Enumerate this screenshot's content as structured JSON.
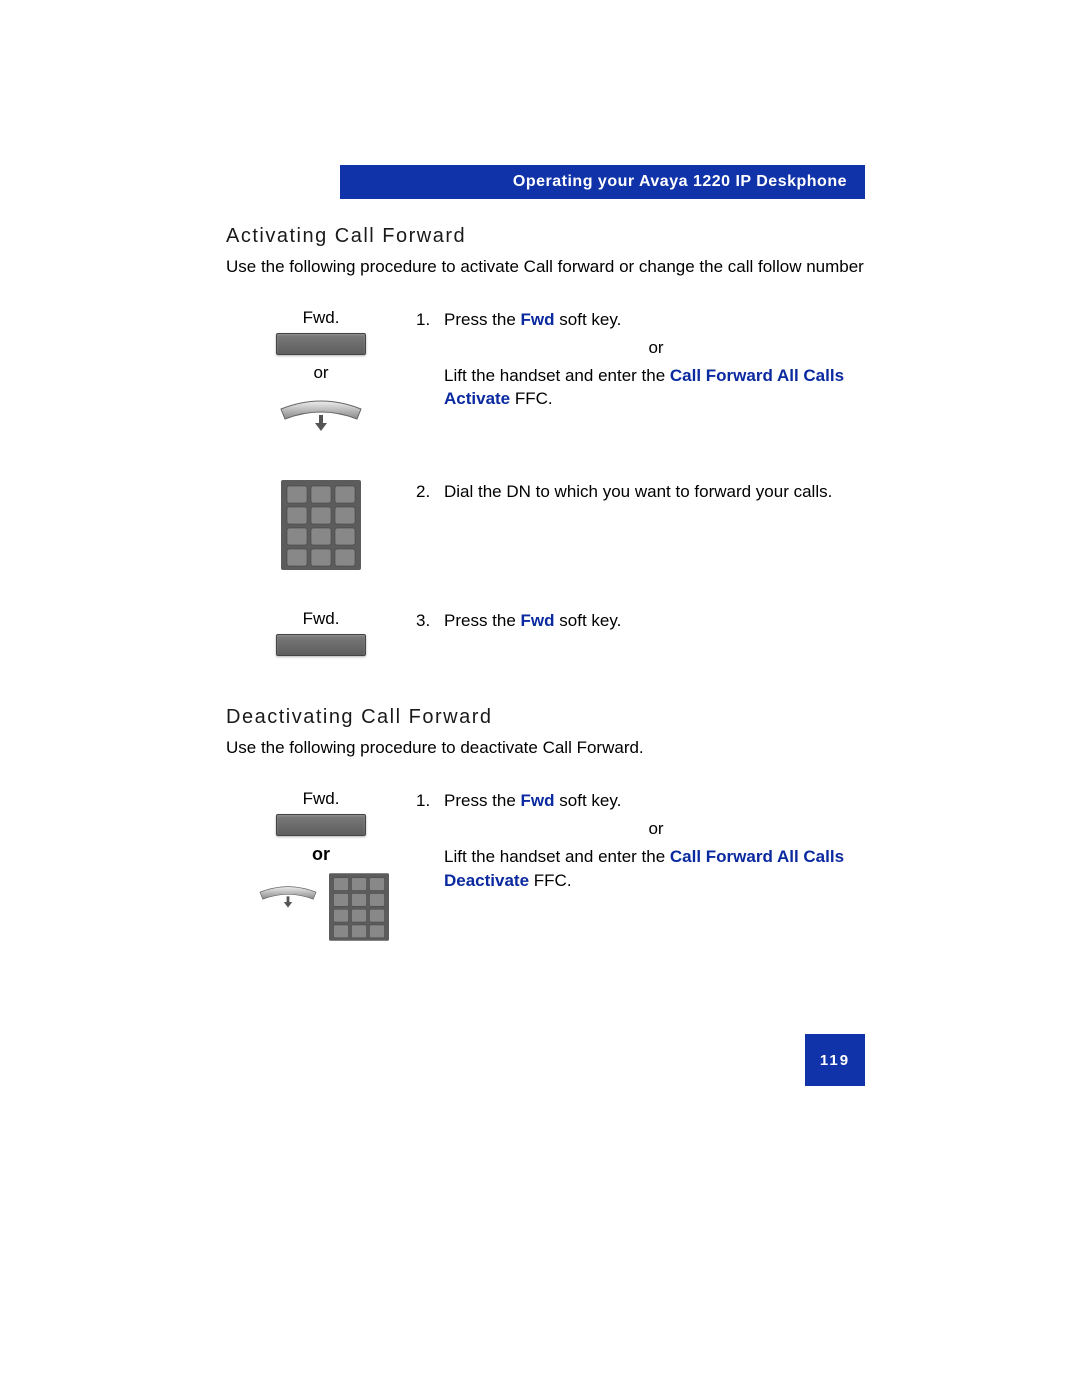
{
  "header": {
    "title": "Operating your Avaya 1220 IP Deskphone"
  },
  "sections": {
    "activate": {
      "title": "Activating Call Forward",
      "intro": "Use the following procedure to activate Call forward or change the call follow number",
      "steps": {
        "s1": {
          "fwd_label": "Fwd.",
          "or_label": "or",
          "num": "1.",
          "text_a": "Press the ",
          "bold_a": "Fwd",
          "text_b": " soft key.",
          "or_center": "or",
          "text_c": "Lift the handset and enter the ",
          "bold_c1": "Call Forward All Calls Activate",
          "text_d": " FFC."
        },
        "s2": {
          "num": "2.",
          "text": "Dial the DN to which you want to forward your calls."
        },
        "s3": {
          "fwd_label": "Fwd.",
          "num": "3.",
          "text_a": "Press the ",
          "bold_a": "Fwd",
          "text_b": " soft key."
        }
      }
    },
    "deactivate": {
      "title": "Deactivating Call Forward",
      "intro": "Use the following procedure to deactivate Call Forward.",
      "steps": {
        "s1": {
          "fwd_label": "Fwd.",
          "or_label": "or",
          "num": "1.",
          "text_a": "Press the ",
          "bold_a": "Fwd",
          "text_b": " soft key.",
          "or_center": "or",
          "text_c": "Lift the handset and enter the ",
          "bold_c1": "Call Forward All Calls Deactivate",
          "text_d": " FFC."
        }
      }
    }
  },
  "page_number": "119"
}
